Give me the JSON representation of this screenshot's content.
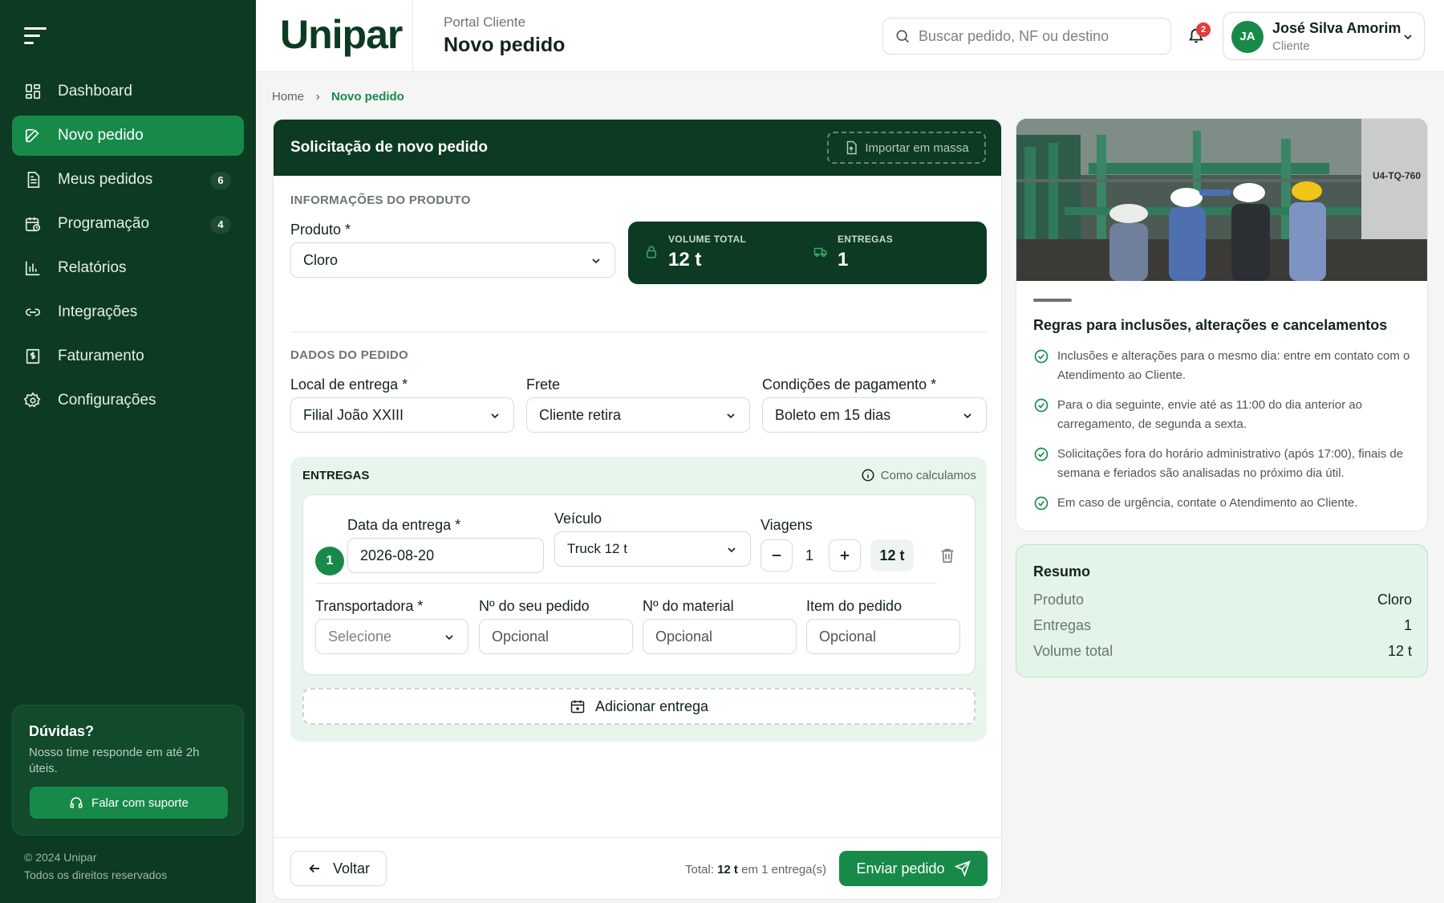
{
  "sidebar": {
    "items": [
      {
        "label": "Dashboard",
        "icon": "dashboard-icon"
      },
      {
        "label": "Novo pedido",
        "icon": "edit-icon",
        "active": true
      },
      {
        "label": "Meus pedidos",
        "icon": "document-icon",
        "badge": "6"
      },
      {
        "label": "Programação",
        "icon": "calendar-clock-icon",
        "badge": "4"
      },
      {
        "label": "Relatórios",
        "icon": "bar-chart-icon"
      },
      {
        "label": "Integrações",
        "icon": "link-icon"
      },
      {
        "label": "Faturamento",
        "icon": "invoice-icon"
      },
      {
        "label": "Configurações",
        "icon": "gear-icon"
      }
    ],
    "help": {
      "title": "Dúvidas?",
      "text": "Nosso time responde em até 2h úteis.",
      "button": "Falar com suporte"
    },
    "copyright_line1": "© 2024 Unipar",
    "copyright_line2": "Todos os direitos reservados"
  },
  "header": {
    "logo": "Unipar",
    "subtitle": "Portal Cliente",
    "title": "Novo pedido",
    "search_placeholder": "Buscar pedido, NF ou destino",
    "notifications": "2",
    "user": {
      "initials": "JA",
      "name": "José Silva Amorim",
      "role": "Cliente"
    }
  },
  "breadcrumb": {
    "home": "Home",
    "current": "Novo pedido"
  },
  "form": {
    "title": "Solicitação de novo pedido",
    "import_label": "Importar em massa",
    "product_section": "INFORMAÇÕES DO PRODUTO",
    "product_label": "Produto *",
    "product_value": "Cloro",
    "volume_label": "VOLUME TOTAL",
    "volume_value": "12 t",
    "entregas_label": "ENTREGAS",
    "entregas_value": "1",
    "order_section": "DADOS DO PEDIDO",
    "local_label": "Local de entrega *",
    "local_value": "Filial João XXIII",
    "frete_label": "Frete",
    "frete_value": "Cliente retira",
    "pagamento_label": "Condições de pagamento *",
    "pagamento_value": "Boleto em 15 dias",
    "deliveries": {
      "title": "ENTREGAS",
      "how_label": "Como calculamos",
      "item": {
        "number": "1",
        "date_label": "Data da entrega *",
        "date_value": "2026-08-20",
        "vehicle_label": "Veículo",
        "vehicle_value": "Truck 12 t",
        "trips_label": "Viagens",
        "trips_value": "1",
        "trip_volume": "12 t",
        "carrier_label": "Transportadora *",
        "carrier_placeholder": "Selecione",
        "order_no_label": "Nº do seu pedido",
        "material_label": "Nº do material",
        "item_label": "Item do pedido",
        "optional_placeholder": "Opcional"
      },
      "add_label": "Adicionar entrega"
    },
    "footer": {
      "back_label": "Voltar",
      "total_prefix": "Total:",
      "total_value": "12 t",
      "total_suffix": "em 1 entrega(s)",
      "send_label": "Enviar pedido"
    }
  },
  "rules": {
    "title": "Regras para inclusões, alterações e cancelamentos",
    "photo_label": "U4-TQ-760",
    "items": [
      "Inclusões e alterações para o mesmo dia: entre em contato com o Atendimento ao Cliente.",
      "Para o dia seguinte, envie até as 11:00 do dia anterior ao carregamento, de segunda a sexta.",
      "Solicitações fora do horário administrativo (após 17:00), finais de semana e feriados são analisadas no próximo dia útil.",
      "Em caso de urgência, contate o Atendimento ao Cliente."
    ]
  },
  "summary": {
    "title": "Resumo",
    "rows": [
      {
        "k": "Produto",
        "v": "Cloro"
      },
      {
        "k": "Entregas",
        "v": "1"
      },
      {
        "k": "Volume total",
        "v": "12 t"
      }
    ]
  },
  "colors": {
    "brand_dark": "#0d3a22",
    "brand_green": "#178a4a",
    "soft_green": "#e8f5ec",
    "alert_red": "#e23b3b"
  }
}
